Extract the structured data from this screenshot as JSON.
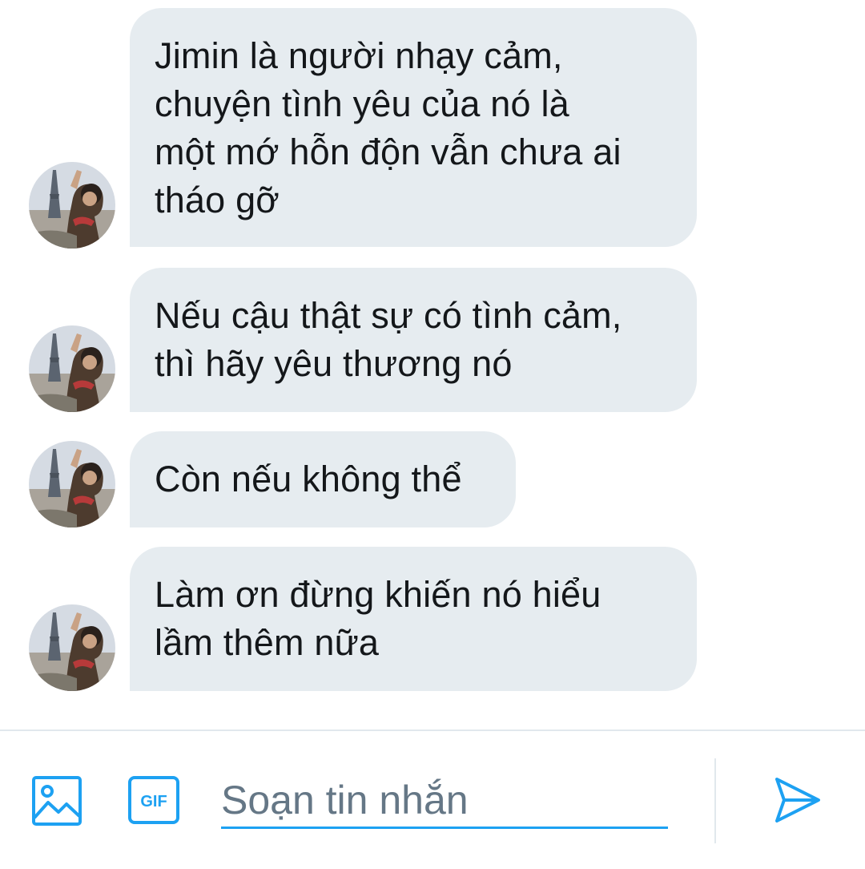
{
  "thread": {
    "messages": [
      {
        "lines": [
          "Jimin là người nhạy cảm,",
          "chuyện tình yêu của nó là",
          "một mớ hỗn độn vẫn chưa ai",
          "tháo gỡ"
        ]
      },
      {
        "lines": [
          "Nếu cậu thật sự có tình cảm,",
          "thì hãy yêu thương nó"
        ]
      },
      {
        "lines": [
          "Còn nếu không thể"
        ]
      },
      {
        "lines": [
          "Làm ơn đừng khiến nó hiểu",
          "lầm thêm nữa"
        ]
      }
    ]
  },
  "composer": {
    "placeholder": "Soạn tin nhắn",
    "value": "",
    "icons": {
      "media": "image-icon",
      "gif": "gif-icon",
      "send": "send-icon"
    },
    "gif_label": "GIF"
  },
  "colors": {
    "accent": "#1da1f2",
    "bubble": "#e6ecf0",
    "text": "#14171a",
    "placeholder": "#657786",
    "divider": "#e1e8ed"
  }
}
